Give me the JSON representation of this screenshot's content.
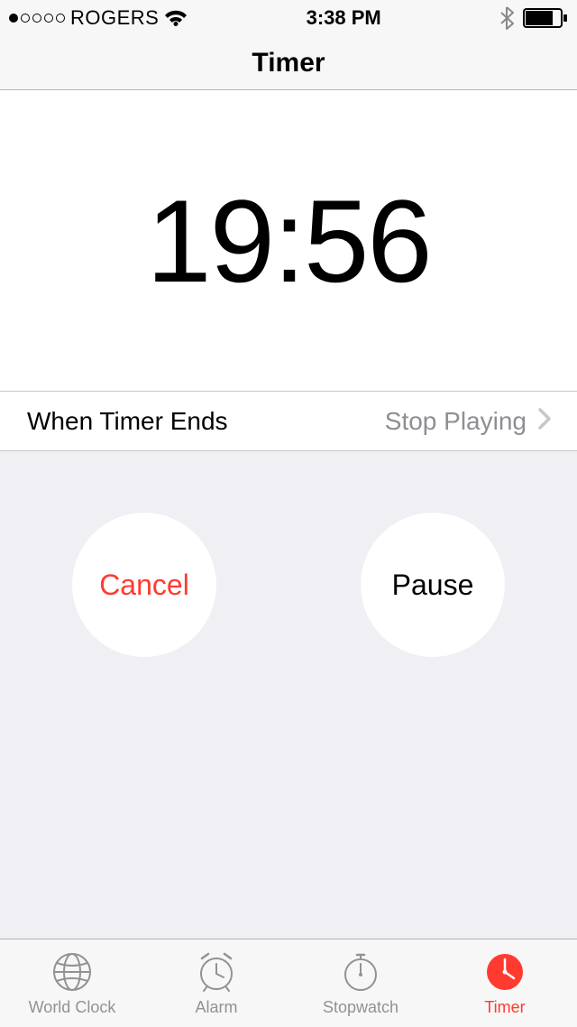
{
  "status_bar": {
    "carrier": "ROGERS",
    "time": "3:38 PM"
  },
  "header": {
    "title": "Timer"
  },
  "timer": {
    "display": "19:56"
  },
  "row": {
    "label": "When Timer Ends",
    "value": "Stop Playing"
  },
  "buttons": {
    "cancel": "Cancel",
    "pause": "Pause"
  },
  "tabs": {
    "world_clock": "World Clock",
    "alarm": "Alarm",
    "stopwatch": "Stopwatch",
    "timer": "Timer"
  }
}
